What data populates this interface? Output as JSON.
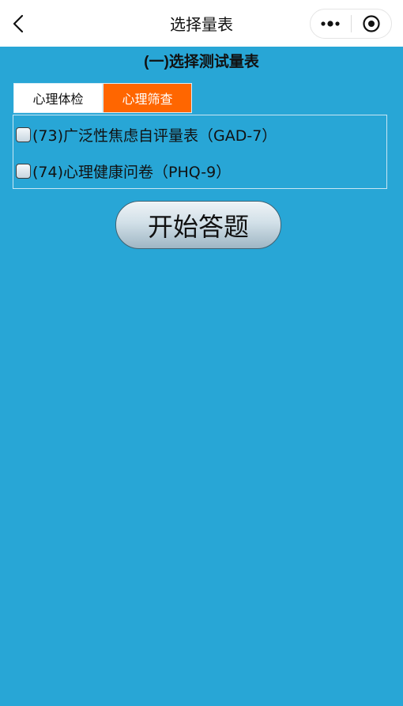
{
  "navbar": {
    "title": "选择量表",
    "back_icon": "chevron-left-icon",
    "more_icon": "more-dots-icon",
    "close_icon": "record-circle-icon"
  },
  "section": {
    "title": "(一)选择测试量表"
  },
  "tabs": [
    {
      "label": "心理体检",
      "active": false
    },
    {
      "label": "心理筛查",
      "active": true,
      "color": "#ff6600"
    }
  ],
  "scales": [
    {
      "label": "(73)广泛性焦虑自评量表（GAD-7）",
      "checked": false
    },
    {
      "label": "(74)心理健康问卷（PHQ-9）",
      "checked": false
    }
  ],
  "start_button": {
    "label": "开始答题"
  },
  "colors": {
    "background": "#28a6d6",
    "active_tab": "#ff6600"
  }
}
